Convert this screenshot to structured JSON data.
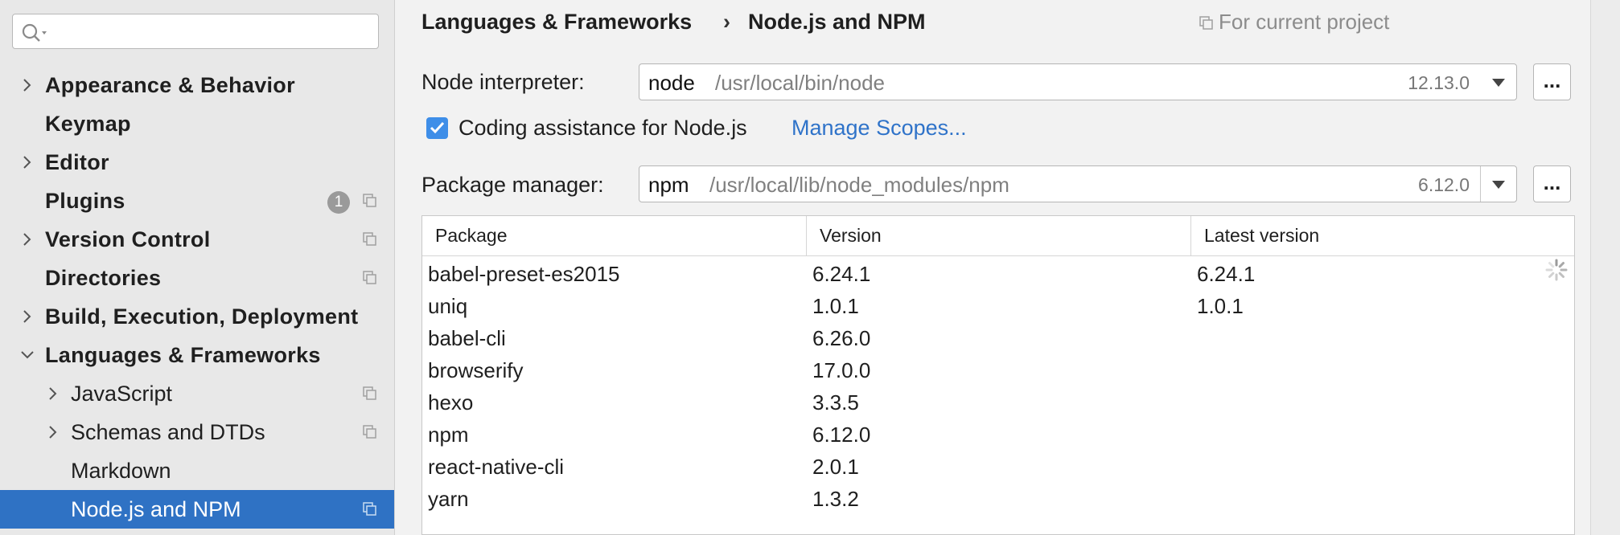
{
  "search": {
    "value": "",
    "placeholder": ""
  },
  "sidebar": {
    "items": [
      {
        "label": "Appearance & Behavior"
      },
      {
        "label": "Keymap"
      },
      {
        "label": "Editor"
      },
      {
        "label": "Plugins",
        "badge": "1"
      },
      {
        "label": "Version Control"
      },
      {
        "label": "Directories"
      },
      {
        "label": "Build, Execution, Deployment"
      },
      {
        "label": "Languages & Frameworks"
      },
      {
        "label": "JavaScript"
      },
      {
        "label": "Schemas and DTDs"
      },
      {
        "label": "Markdown"
      },
      {
        "label": "Node.js and NPM"
      }
    ]
  },
  "header": {
    "breadcrumb": [
      "Languages & Frameworks",
      "Node.js and NPM"
    ],
    "separator": "›",
    "scope": "For current project"
  },
  "node_interpreter": {
    "label": "Node interpreter:",
    "name": "node",
    "path": "/usr/local/bin/node",
    "version": "12.13.0",
    "browse": "..."
  },
  "coding_assistance": {
    "checked": true,
    "label": "Coding assistance for Node.js",
    "link": "Manage Scopes..."
  },
  "package_manager": {
    "label": "Package manager:",
    "name": "npm",
    "path": "/usr/local/lib/node_modules/npm",
    "version": "6.12.0",
    "browse": "..."
  },
  "packages": {
    "columns": [
      "Package",
      "Version",
      "Latest version"
    ],
    "rows": [
      {
        "package": "babel-preset-es2015",
        "version": "6.24.1",
        "latest": "6.24.1"
      },
      {
        "package": "uniq",
        "version": "1.0.1",
        "latest": "1.0.1"
      },
      {
        "package": "babel-cli",
        "version": "6.26.0",
        "latest": ""
      },
      {
        "package": "browserify",
        "version": "17.0.0",
        "latest": ""
      },
      {
        "package": "hexo",
        "version": "3.3.5",
        "latest": ""
      },
      {
        "package": "npm",
        "version": "6.12.0",
        "latest": ""
      },
      {
        "package": "react-native-cli",
        "version": "2.0.1",
        "latest": ""
      },
      {
        "package": "yarn",
        "version": "1.3.2",
        "latest": ""
      }
    ]
  },
  "colors": {
    "selection": "#2f72c4",
    "link": "#2f73c9",
    "checkbox": "#3e8ee8"
  }
}
